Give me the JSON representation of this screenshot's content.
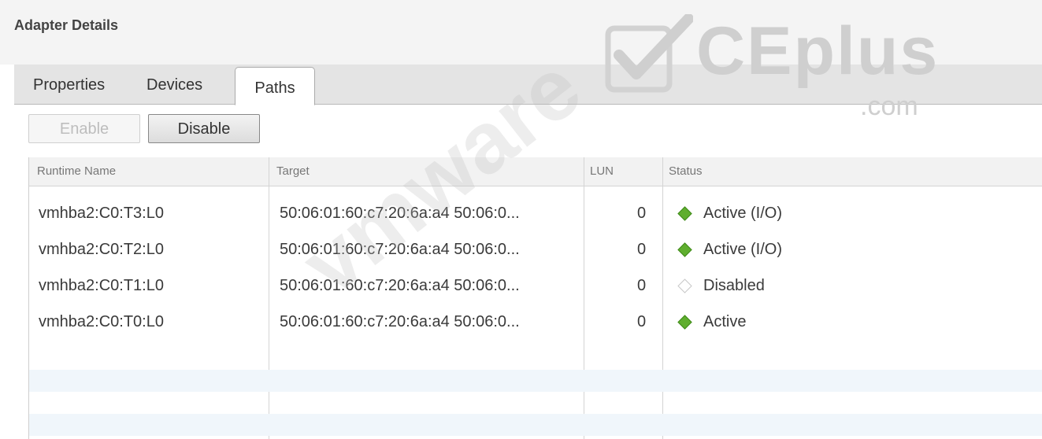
{
  "panel": {
    "title": "Adapter Details"
  },
  "tabs": [
    {
      "label": "Properties"
    },
    {
      "label": "Devices"
    },
    {
      "label": "Paths",
      "active": true
    }
  ],
  "toolbar": {
    "enable_label": "Enable",
    "disable_label": "Disable"
  },
  "table": {
    "columns": [
      "Runtime Name",
      "Target",
      "LUN",
      "Status"
    ],
    "rows": [
      {
        "runtime_name": "vmhba2:C0:T3:L0",
        "target": "50:06:01:60:c7:20:6a:a4 50:06:0...",
        "lun": "0",
        "status": "Active (I/O)",
        "status_icon": "green-diamond-icon"
      },
      {
        "runtime_name": "vmhba2:C0:T2:L0",
        "target": "50:06:01:60:c7:20:6a:a4 50:06:0...",
        "lun": "0",
        "status": "Active (I/O)",
        "status_icon": "green-diamond-icon"
      },
      {
        "runtime_name": "vmhba2:C0:T1:L0",
        "target": "50:06:01:60:c7:20:6a:a4 50:06:0...",
        "lun": "0",
        "status": "Disabled",
        "status_icon": "empty-diamond-icon"
      },
      {
        "runtime_name": "vmhba2:C0:T0:L0",
        "target": "50:06:01:60:c7:20:6a:a4 50:06:0...",
        "lun": "0",
        "status": "Active",
        "status_icon": "green-diamond-icon"
      }
    ]
  },
  "watermark": {
    "brand": "CEplus",
    "domain": ".com",
    "overlay": "vmware"
  },
  "colors": {
    "active_status": "#5fae2e",
    "header_bg": "#f2f2f2",
    "tabbar_bg": "#e4e4e4"
  }
}
